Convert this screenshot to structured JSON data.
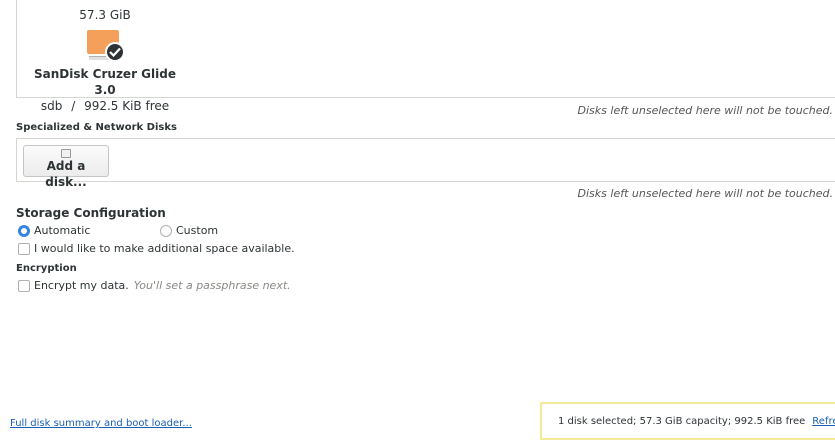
{
  "local_disk": {
    "size": "57.3 GiB",
    "name": "SanDisk Cruzer Glide 3.0",
    "device": "sdb",
    "separator": "/",
    "free": "992.5 KiB free",
    "icon": "usb-drive-icon",
    "icon_color": "#f5a05a",
    "selected": true
  },
  "hints": {
    "local": "Disks left unselected here will not be touched.",
    "network": "Disks left unselected here will not be touched."
  },
  "network": {
    "title": "Specialized & Network Disks",
    "add_button": "Add a disk..."
  },
  "storage": {
    "title": "Storage Configuration",
    "automatic_label": "Automatic",
    "custom_label": "Custom",
    "selected": "Automatic",
    "space_label": "I would like to make additional space available."
  },
  "encryption": {
    "title": "Encryption",
    "checkbox_label": "Encrypt my data.",
    "note": "You'll set a passphrase next."
  },
  "footer": {
    "summary_link": "Full disk summary and boot loader...",
    "status": "1 disk selected; 57.3 GiB capacity; 992.5 KiB free",
    "refresh": "Refresh..."
  },
  "colors": {
    "accent": "#3584e4",
    "link": "#1a5fb4",
    "status_border": "#f3ea9a"
  }
}
